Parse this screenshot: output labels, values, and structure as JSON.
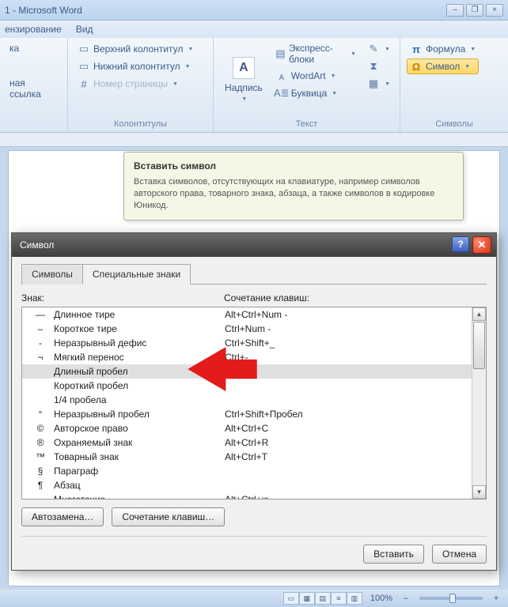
{
  "window": {
    "title": "1 - Microsoft Word"
  },
  "menu": {
    "review": "ензирование",
    "view": "Вид"
  },
  "ribbon": {
    "links": {
      "item1": "ка",
      "item2": "ная ссылка"
    },
    "headerfooter": {
      "header": "Верхний колонтитул",
      "footer": "Нижний колонтитул",
      "pagenum": "Номер страницы",
      "group": "Колонтитулы"
    },
    "text": {
      "textbox": "Надпись",
      "quickparts": "Экспресс-блоки",
      "wordart": "WordArt",
      "dropcap": "Буквица",
      "group": "Текст"
    },
    "symbols": {
      "equation": "Формула",
      "symbol": "Символ",
      "group": "Символы"
    }
  },
  "tooltip": {
    "title": "Вставить символ",
    "body": "Вставка символов, отсутствующих на клавиатуре, например символов авторского права, товарного знака, абзаца, а также символов в кодировке Юникод."
  },
  "dialog": {
    "title": "Символ",
    "tabs": {
      "symbols": "Символы",
      "special": "Специальные знаки"
    },
    "col_char": "Знак:",
    "col_shortcut": "Сочетание клавиш:",
    "rows": [
      {
        "sym": "—",
        "name": "Длинное тире",
        "keys": "Alt+Ctrl+Num -"
      },
      {
        "sym": "–",
        "name": "Короткое тире",
        "keys": "Ctrl+Num -"
      },
      {
        "sym": "-",
        "name": "Неразрывный дефис",
        "keys": "Ctrl+Shift+_"
      },
      {
        "sym": "¬",
        "name": "Мягкий перенос",
        "keys": "Ctrl+-"
      },
      {
        "sym": "",
        "name": "Длинный пробел",
        "keys": ""
      },
      {
        "sym": "",
        "name": "Короткий пробел",
        "keys": ""
      },
      {
        "sym": "",
        "name": "1/4 пробела",
        "keys": ""
      },
      {
        "sym": "°",
        "name": "Неразрывный пробел",
        "keys": "Ctrl+Shift+Пробел"
      },
      {
        "sym": "©",
        "name": "Авторское право",
        "keys": "Alt+Ctrl+C"
      },
      {
        "sym": "®",
        "name": "Охраняемый знак",
        "keys": "Alt+Ctrl+R"
      },
      {
        "sym": "™",
        "name": "Товарный знак",
        "keys": "Alt+Ctrl+T"
      },
      {
        "sym": "§",
        "name": "Параграф",
        "keys": ""
      },
      {
        "sym": "¶",
        "name": "Абзац",
        "keys": ""
      },
      {
        "sym": "…",
        "name": "Многоточие",
        "keys": "Alt+Ctrl+ю"
      }
    ],
    "autocorrect": "Автозамена…",
    "shortcut_btn": "Сочетание клавиш…",
    "insert": "Вставить",
    "cancel": "Отмена"
  },
  "status": {
    "zoom": "100%"
  }
}
